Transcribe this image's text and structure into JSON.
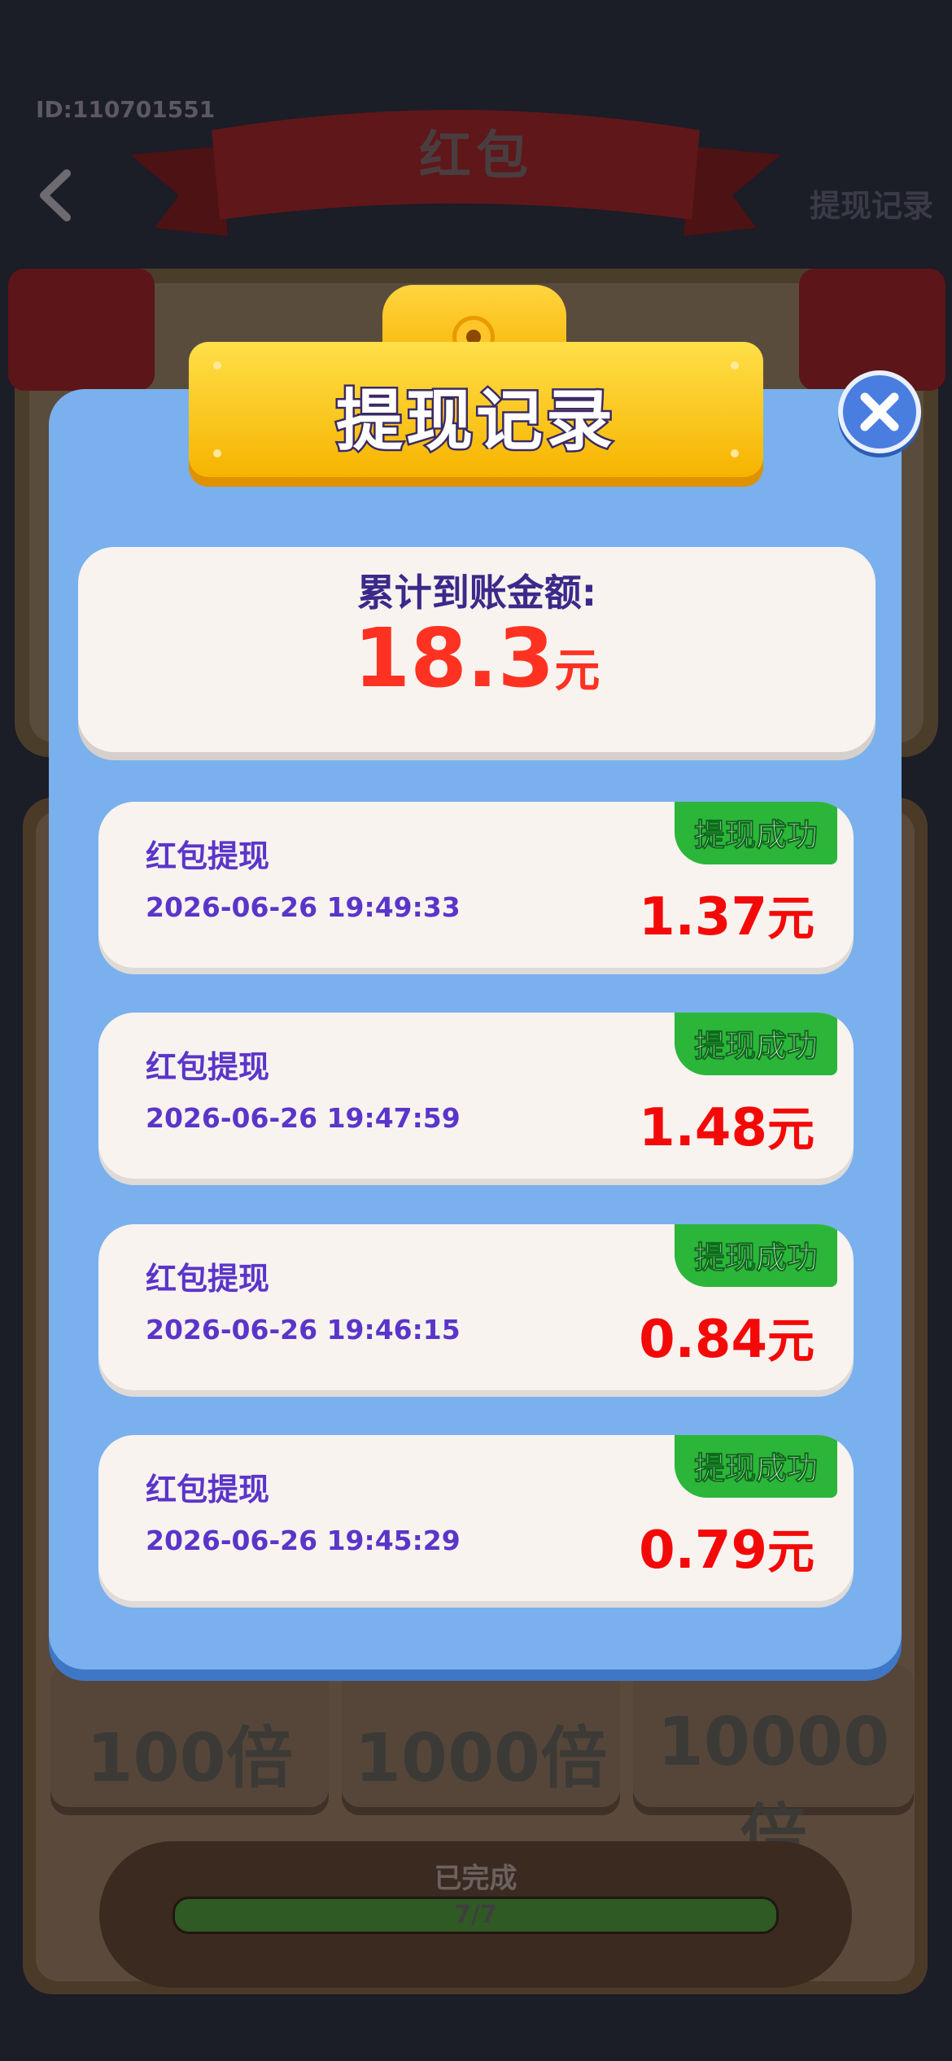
{
  "background": {
    "user_id": "ID:110701551",
    "title": "红包",
    "withdraw_record_link": "提现记录",
    "multipliers": [
      "100倍",
      "1000倍",
      "10000倍"
    ],
    "progress": {
      "label": "已完成",
      "text": "7/7",
      "fraction": 1.0
    }
  },
  "modal": {
    "title": "提现记录",
    "total_label": "累计到账金额:",
    "total_amount": "18.3",
    "total_unit": "元",
    "records": [
      {
        "title": "红包提现",
        "time": "2026-06-26 19:49:33",
        "amount": "1.37",
        "unit": "元",
        "status": "提现成功"
      },
      {
        "title": "红包提现",
        "time": "2026-06-26 19:47:59",
        "amount": "1.48",
        "unit": "元",
        "status": "提现成功"
      },
      {
        "title": "红包提现",
        "time": "2026-06-26 19:46:15",
        "amount": "0.84",
        "unit": "元",
        "status": "提现成功"
      },
      {
        "title": "红包提现",
        "time": "2026-06-26 19:45:29",
        "amount": "0.79",
        "unit": "元",
        "status": "提现成功"
      }
    ]
  },
  "colors": {
    "modal_bg": "#7ab0ee",
    "title_gold": "#f6b400",
    "amount_red": "#f40909",
    "status_green": "#2bb63a",
    "text_purple": "#5b35c9"
  }
}
